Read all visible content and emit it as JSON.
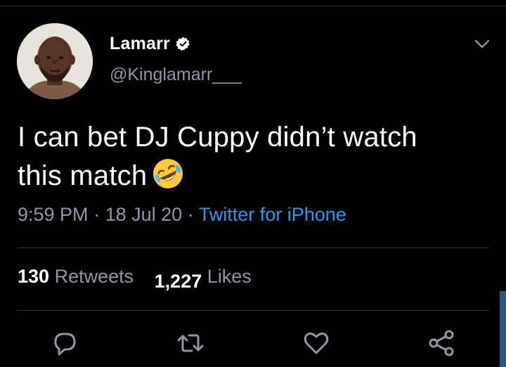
{
  "tweet": {
    "author": {
      "display_name": "Lamarr",
      "handle": "@Kinglamarr___",
      "verified": true
    },
    "text_line1": "I can bet DJ Cuppy didn’t watch",
    "text_line2": "this match",
    "emoji": "rolling-on-floor-laughing",
    "time": "9:59 PM",
    "separator": "·",
    "date": "18 Jul 20",
    "source": "Twitter for iPhone",
    "stats": {
      "retweets_count": "130",
      "retweets_label": "Retweets",
      "likes_count": "1,227",
      "likes_label": "Likes"
    }
  },
  "actions": [
    "reply-icon",
    "retweet-icon",
    "like-icon",
    "share-icon"
  ],
  "colors": {
    "background": "#000000",
    "text": "#ffffff",
    "secondary": "#8b98a5",
    "link": "#1d9bf0",
    "divider": "#2f3336"
  }
}
